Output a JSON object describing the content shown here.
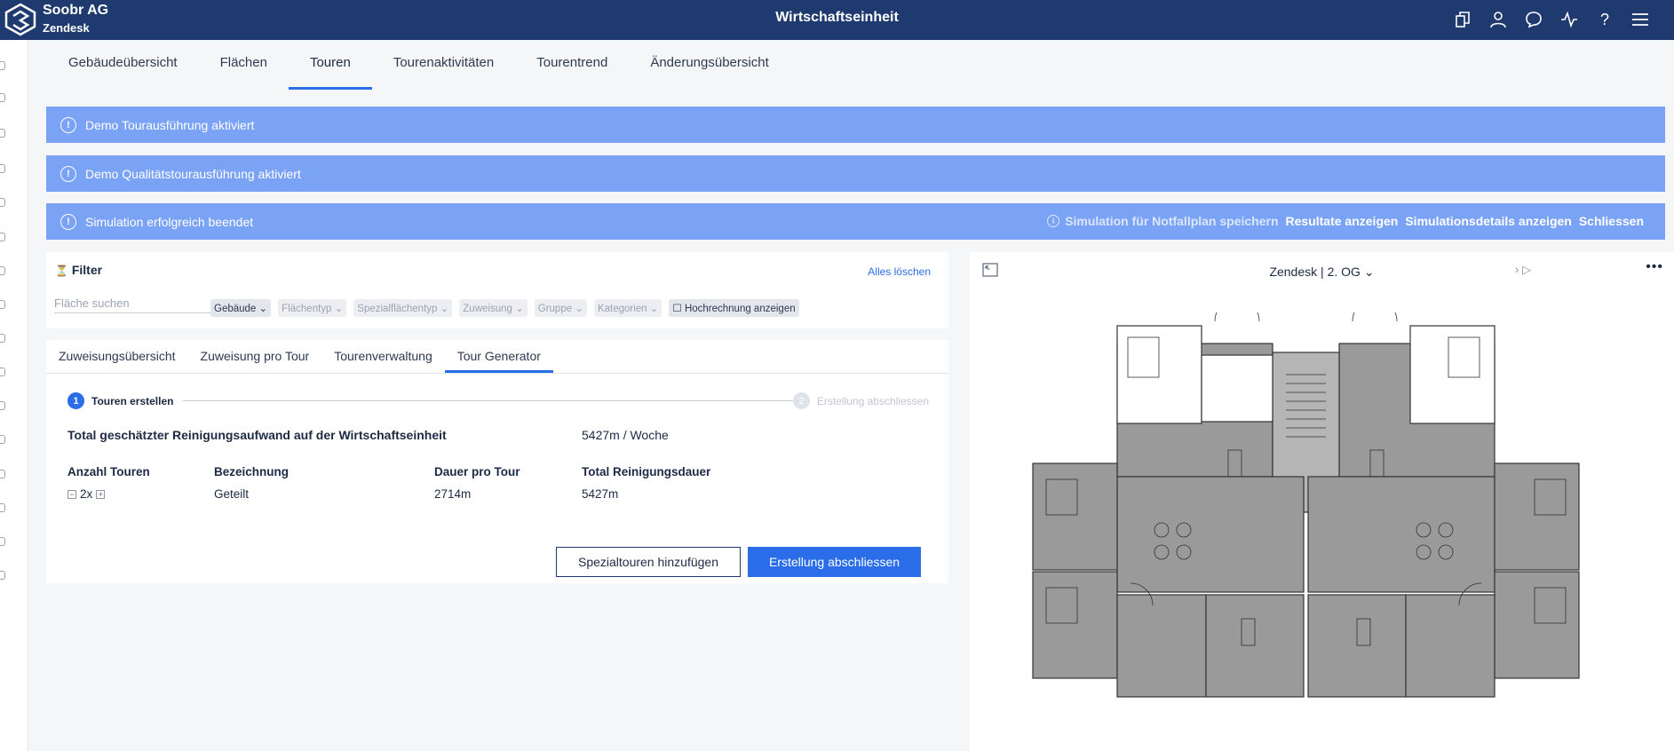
{
  "header": {
    "company": "Soobr AG",
    "client": "Zendesk",
    "title": "Wirtschaftseinheit",
    "icons": [
      "buildings-icon",
      "user-icon",
      "chat-icon",
      "activity-icon",
      "help-icon",
      "menu-icon"
    ]
  },
  "main_tabs": [
    {
      "label": "Gebäudeübersicht",
      "active": false
    },
    {
      "label": "Flächen",
      "active": false
    },
    {
      "label": "Touren",
      "active": true
    },
    {
      "label": "Tourenaktivitäten",
      "active": false
    },
    {
      "label": "Tourentrend",
      "active": false
    },
    {
      "label": "Änderungsübersicht",
      "active": false
    }
  ],
  "banners": {
    "tour_execution": "Demo Tourausführung aktiviert",
    "quality_tour": "Demo Qualitätstourausführung aktiviert",
    "simulation": "Simulation erfolgreich beendet",
    "save_emergency": "Simulation für Notfallplan speichern",
    "show_results": "Resultate anzeigen",
    "show_details": "Simulationsdetails anzeigen",
    "close": "Schliessen"
  },
  "filter": {
    "title": "Filter",
    "clear_all": "Alles löschen",
    "search_placeholder": "Fläche suchen",
    "chips": [
      "Gebäude",
      "Flächentyp",
      "Spezialflächentyp",
      "Zuweisung",
      "Gruppe",
      "Kategorien",
      "Hochrechnung anzeigen"
    ]
  },
  "sub_tabs": [
    {
      "label": "Zuweisungsübersicht",
      "active": false
    },
    {
      "label": "Zuweisung pro Tour",
      "active": false
    },
    {
      "label": "Tourenverwaltung",
      "active": false
    },
    {
      "label": "Tour Generator",
      "active": true
    }
  ],
  "generator": {
    "step1_num": "1",
    "step1_label": "Touren erstellen",
    "step2_num": "2",
    "step2_label": "Erstellung abschliessen",
    "total_label": "Total geschätzter Reinigungsaufwand auf der Wirtschaftseinheit",
    "total_value": "5427m / Woche",
    "columns": {
      "count": "Anzahl Touren",
      "name": "Bezeichnung",
      "duration": "Dauer pro Tour",
      "total": "Total Reinigungsdauer"
    },
    "row": {
      "count": "2x",
      "name": "Geteilt",
      "duration": "2714m",
      "total": "5427m"
    },
    "add_special": "Spezialtouren hinzufügen",
    "finish": "Erstellung abschliessen"
  },
  "plan": {
    "building": "Zendesk",
    "separator": "|",
    "floor": "2. OG"
  }
}
